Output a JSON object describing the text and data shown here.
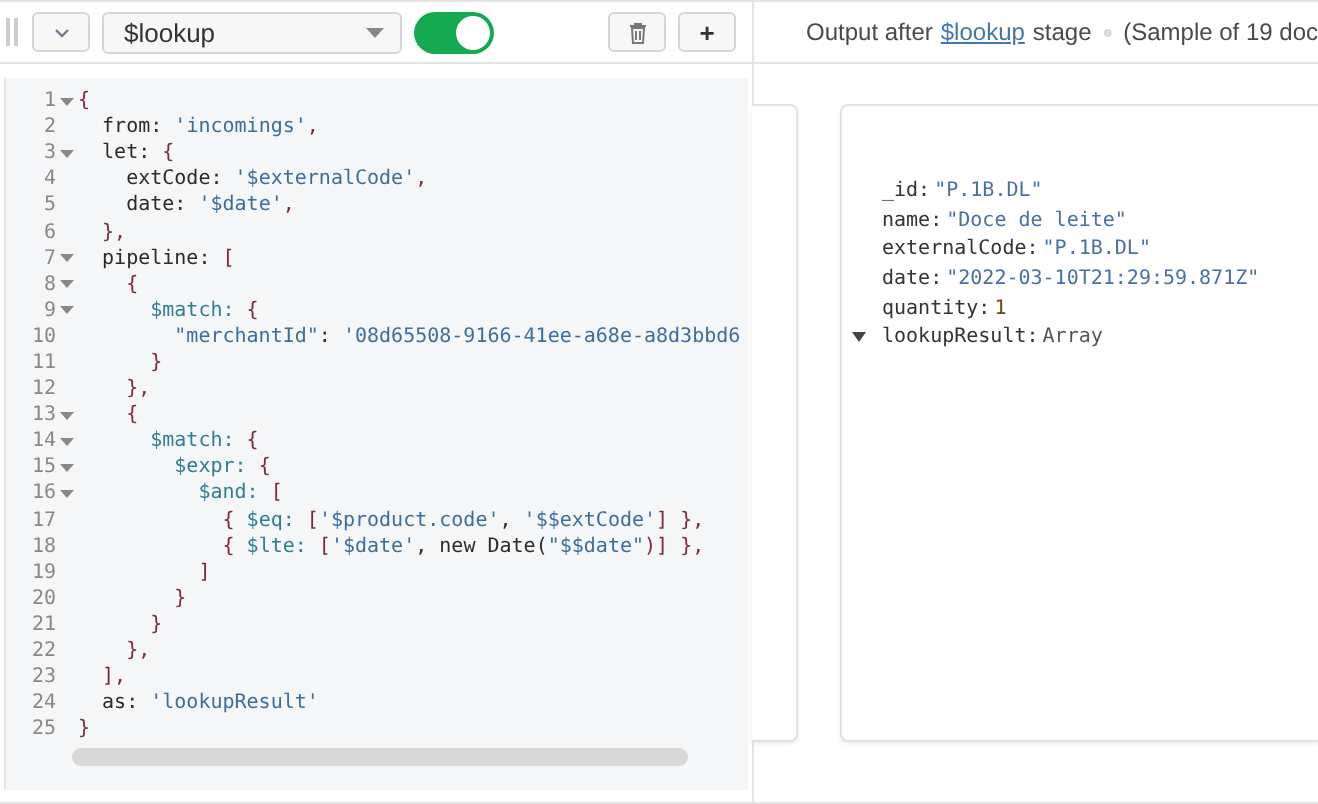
{
  "stage_toolbar": {
    "stage_operator": "$lookup",
    "enabled": true,
    "add_label": "+"
  },
  "output_header": {
    "prefix": "Output after",
    "link": "$lookup",
    "suffix": "stage",
    "sample": "(Sample of 19 doc"
  },
  "editor": {
    "lines": [
      {
        "number": "1",
        "foldable": true,
        "tokens": [
          {
            "kind": "punct",
            "text": "{"
          }
        ]
      },
      {
        "number": "2",
        "foldable": false,
        "tokens": [
          {
            "kind": "key",
            "text": "  from: "
          },
          {
            "kind": "string",
            "text": "'incomings'"
          },
          {
            "kind": "punct",
            "text": ","
          }
        ]
      },
      {
        "number": "3",
        "foldable": true,
        "tokens": [
          {
            "kind": "key",
            "text": "  let: "
          },
          {
            "kind": "punct",
            "text": "{"
          }
        ]
      },
      {
        "number": "4",
        "foldable": false,
        "tokens": [
          {
            "kind": "key",
            "text": "    extCode: "
          },
          {
            "kind": "string",
            "text": "'$externalCode'"
          },
          {
            "kind": "punct",
            "text": ","
          }
        ]
      },
      {
        "number": "5",
        "foldable": false,
        "tokens": [
          {
            "kind": "key",
            "text": "    date: "
          },
          {
            "kind": "string",
            "text": "'$date'"
          },
          {
            "kind": "punct",
            "text": ","
          }
        ]
      },
      {
        "number": "6",
        "foldable": false,
        "tokens": [
          {
            "kind": "punct",
            "text": "  },"
          }
        ]
      },
      {
        "number": "7",
        "foldable": true,
        "tokens": [
          {
            "kind": "key",
            "text": "  pipeline: "
          },
          {
            "kind": "punct",
            "text": "["
          }
        ]
      },
      {
        "number": "8",
        "foldable": true,
        "tokens": [
          {
            "kind": "punct",
            "text": "    {"
          }
        ]
      },
      {
        "number": "9",
        "foldable": true,
        "tokens": [
          {
            "kind": "operator",
            "text": "      $match: "
          },
          {
            "kind": "punct",
            "text": "{"
          }
        ]
      },
      {
        "number": "10",
        "foldable": false,
        "tokens": [
          {
            "kind": "string",
            "text": "        \"merchantId\""
          },
          {
            "kind": "key",
            "text": ": "
          },
          {
            "kind": "string",
            "text": "'08d65508-9166-41ee-a68e-a8d3bbd6"
          }
        ]
      },
      {
        "number": "11",
        "foldable": false,
        "tokens": [
          {
            "kind": "punct",
            "text": "      }"
          }
        ]
      },
      {
        "number": "12",
        "foldable": false,
        "tokens": [
          {
            "kind": "punct",
            "text": "    },"
          }
        ]
      },
      {
        "number": "13",
        "foldable": true,
        "tokens": [
          {
            "kind": "punct",
            "text": "    {"
          }
        ]
      },
      {
        "number": "14",
        "foldable": true,
        "tokens": [
          {
            "kind": "operator",
            "text": "      $match: "
          },
          {
            "kind": "punct",
            "text": "{"
          }
        ]
      },
      {
        "number": "15",
        "foldable": true,
        "tokens": [
          {
            "kind": "operator",
            "text": "        $expr: "
          },
          {
            "kind": "punct",
            "text": "{"
          }
        ]
      },
      {
        "number": "16",
        "foldable": true,
        "tokens": [
          {
            "kind": "operator",
            "text": "          $and: "
          },
          {
            "kind": "punct",
            "text": "["
          }
        ]
      },
      {
        "number": "17",
        "foldable": false,
        "tokens": [
          {
            "kind": "punct",
            "text": "            { "
          },
          {
            "kind": "operator",
            "text": "$eq: "
          },
          {
            "kind": "punct",
            "text": "["
          },
          {
            "kind": "string",
            "text": "'$product.code'"
          },
          {
            "kind": "key",
            "text": ", "
          },
          {
            "kind": "string",
            "text": "'$$extCode'"
          },
          {
            "kind": "punct",
            "text": "] },"
          }
        ]
      },
      {
        "number": "18",
        "foldable": false,
        "tokens": [
          {
            "kind": "punct",
            "text": "            { "
          },
          {
            "kind": "operator",
            "text": "$lte: "
          },
          {
            "kind": "punct",
            "text": "["
          },
          {
            "kind": "string",
            "text": "'$date'"
          },
          {
            "kind": "key",
            "text": ", new Date("
          },
          {
            "kind": "string",
            "text": "\"$$date\""
          },
          {
            "kind": "punct",
            "text": ")] },"
          }
        ]
      },
      {
        "number": "19",
        "foldable": false,
        "tokens": [
          {
            "kind": "punct",
            "text": "          ]"
          }
        ]
      },
      {
        "number": "20",
        "foldable": false,
        "tokens": [
          {
            "kind": "punct",
            "text": "        }"
          }
        ]
      },
      {
        "number": "21",
        "foldable": false,
        "tokens": [
          {
            "kind": "punct",
            "text": "      }"
          }
        ]
      },
      {
        "number": "22",
        "foldable": false,
        "tokens": [
          {
            "kind": "punct",
            "text": "    },"
          }
        ]
      },
      {
        "number": "23",
        "foldable": false,
        "tokens": [
          {
            "kind": "punct",
            "text": "  ],"
          }
        ]
      },
      {
        "number": "24",
        "foldable": false,
        "tokens": [
          {
            "kind": "key",
            "text": "  as: "
          },
          {
            "kind": "string",
            "text": "'lookupResult'"
          }
        ]
      },
      {
        "number": "25",
        "foldable": false,
        "tokens": [
          {
            "kind": "punct",
            "text": "}"
          }
        ]
      }
    ]
  },
  "document": {
    "fields": [
      {
        "key": "_id:",
        "value": "\"P.1B.DL\"",
        "kind": "string"
      },
      {
        "key": "name:",
        "value": "\"Doce de leite\"",
        "kind": "string"
      },
      {
        "key": "externalCode:",
        "value": "\"P.1B.DL\"",
        "kind": "string"
      },
      {
        "key": "date:",
        "value": "\"2022-03-10T21:29:59.871Z\"",
        "kind": "string"
      },
      {
        "key": "quantity:",
        "value": "1",
        "kind": "number"
      },
      {
        "key": "lookupResult:",
        "value": "Array",
        "kind": "array",
        "expanded": true
      }
    ]
  }
}
